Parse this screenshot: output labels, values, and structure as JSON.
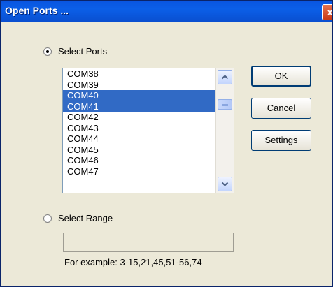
{
  "window": {
    "title": "Open Ports ...",
    "close_glyph": "x"
  },
  "select_ports": {
    "label": "Select Ports",
    "checked": true
  },
  "ports_list": {
    "items": [
      {
        "label": "COM38",
        "selected": false
      },
      {
        "label": "COM39",
        "selected": false
      },
      {
        "label": "COM40",
        "selected": true
      },
      {
        "label": "COM41",
        "selected": true
      },
      {
        "label": "COM42",
        "selected": false
      },
      {
        "label": "COM43",
        "selected": false
      },
      {
        "label": "COM44",
        "selected": false
      },
      {
        "label": "COM45",
        "selected": false
      },
      {
        "label": "COM46",
        "selected": false
      },
      {
        "label": "COM47",
        "selected": false
      }
    ]
  },
  "buttons": {
    "ok": "OK",
    "cancel": "Cancel",
    "settings": "Settings"
  },
  "select_range": {
    "label": "Select Range",
    "checked": false,
    "value": "",
    "example": "For example: 3-15,21,45,51-56,74"
  },
  "colors": {
    "title_bar": "#0a55e0",
    "selection": "#316ac5",
    "dialog_face": "#ece9d8"
  },
  "icons": {
    "close": "close-icon",
    "scroll_up": "chevron-up-icon",
    "scroll_down": "chevron-down-icon"
  }
}
